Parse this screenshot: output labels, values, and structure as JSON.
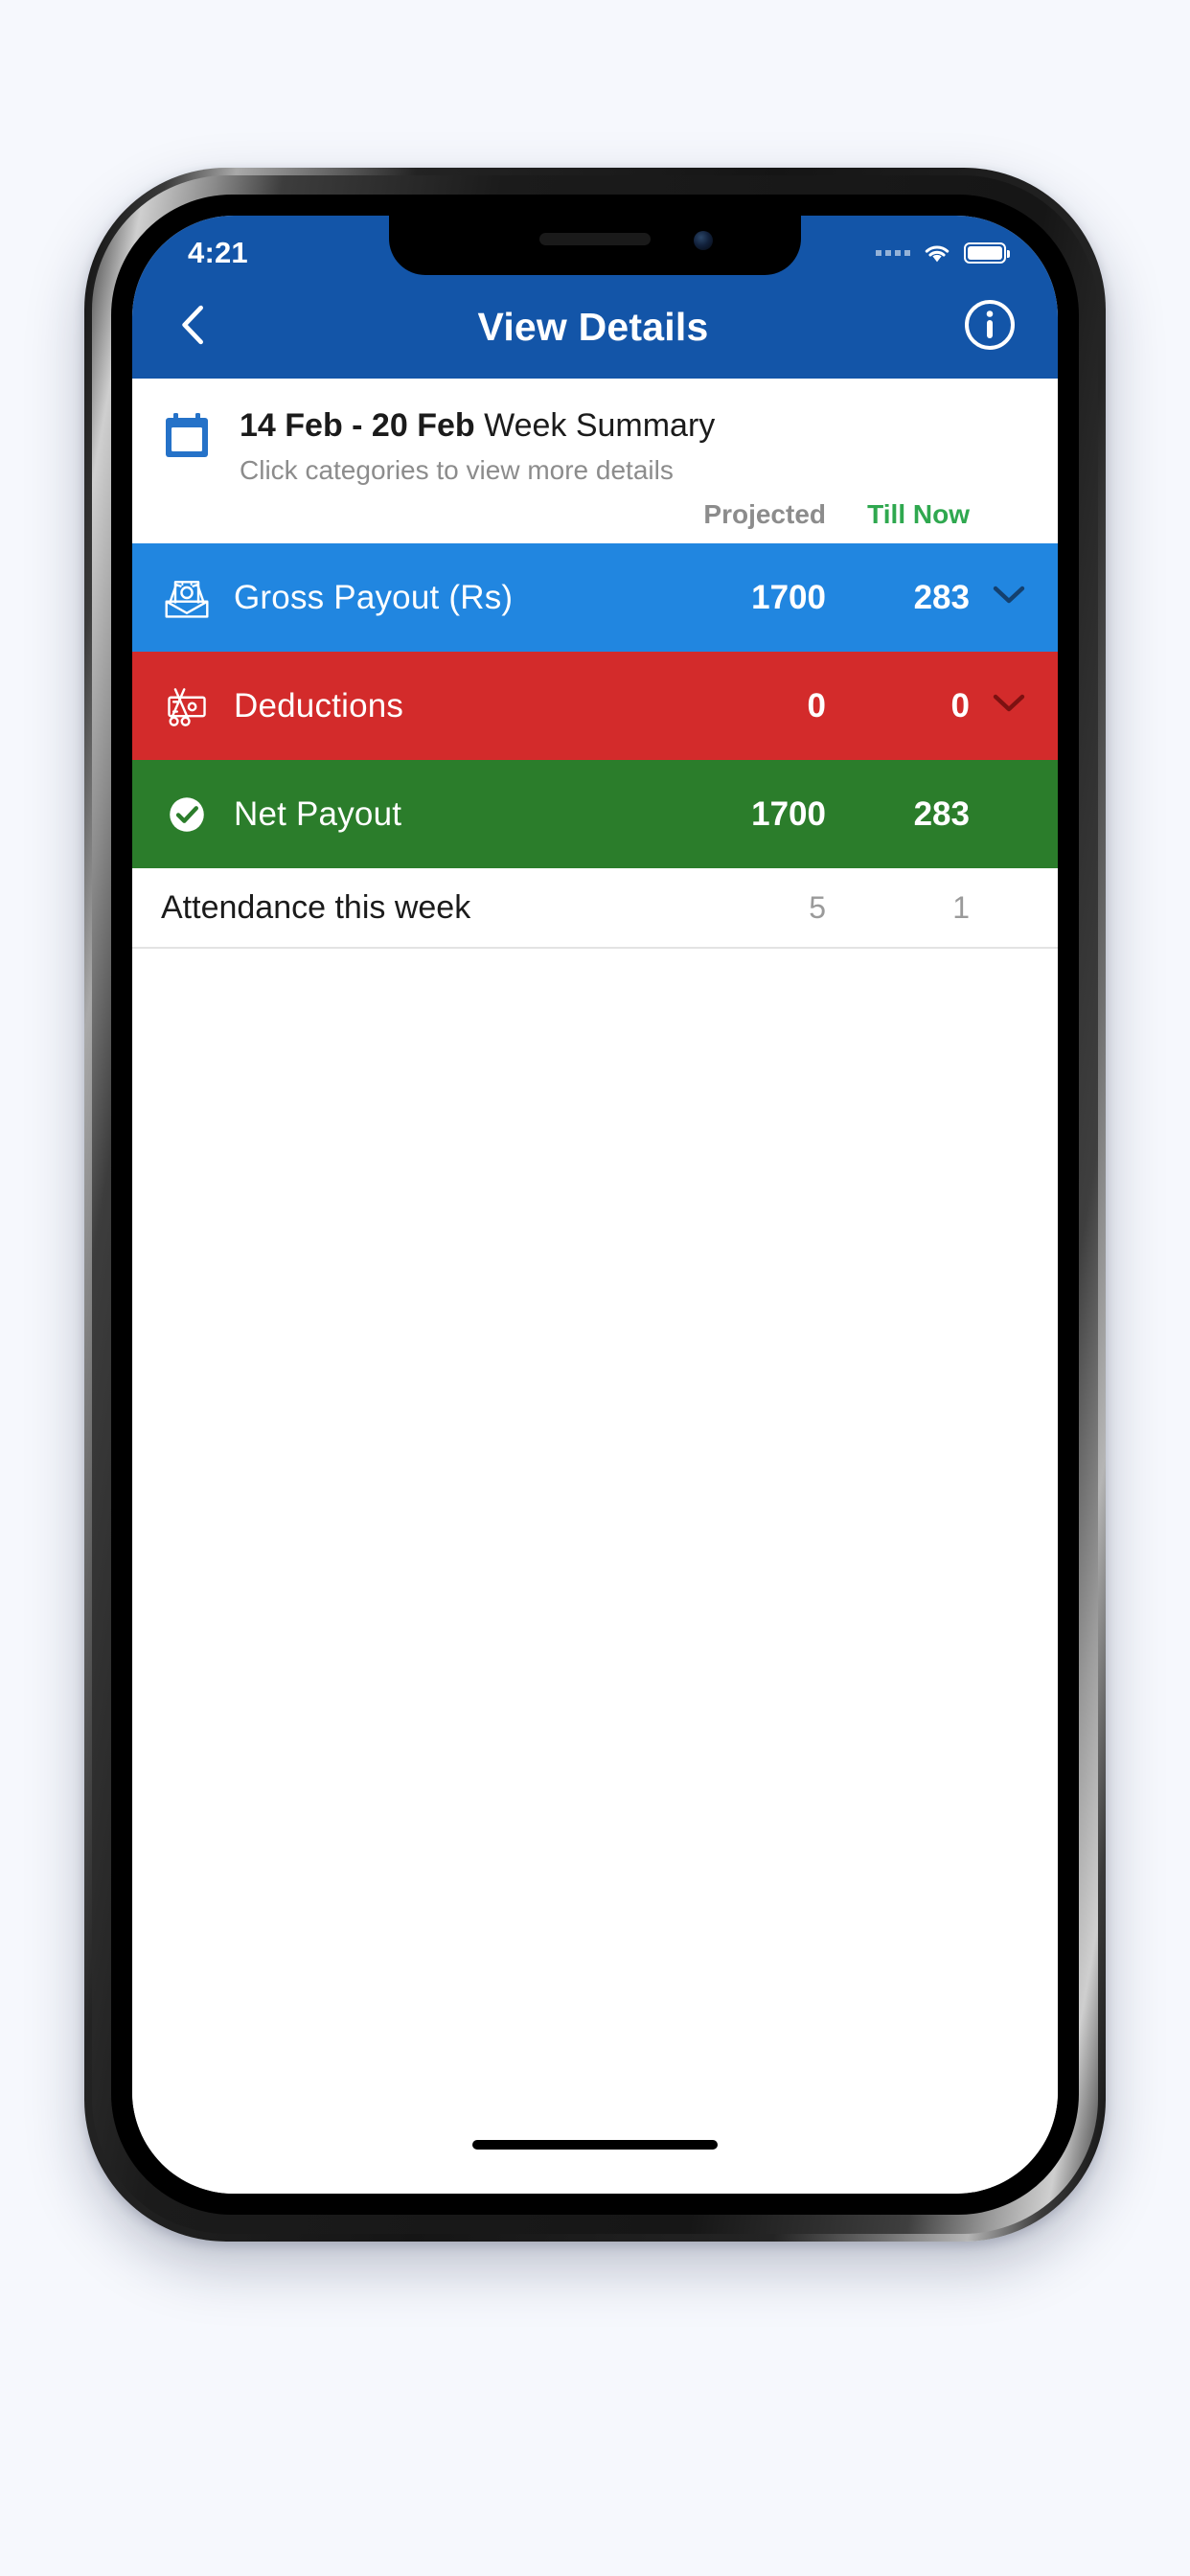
{
  "device": {
    "status_bar": {
      "time": "4:21",
      "signal_icon": "signal-dots-icon",
      "wifi_icon": "wifi-icon",
      "battery_icon": "battery-full-icon"
    },
    "home_indicator": "home-indicator"
  },
  "app_bar": {
    "back_icon": "chevron-left-icon",
    "title": "View Details",
    "info_icon": "info-circle-icon",
    "background_color": "#1355a8"
  },
  "summary": {
    "calendar_icon": "calendar-icon",
    "date_range": "14 Feb - 20 Feb",
    "title_suffix": " Week Summary",
    "subtitle": "Click categories to view more details"
  },
  "columns": {
    "projected_label": "Projected",
    "projected_color": "#8c8c8c",
    "till_now_label": "Till Now",
    "till_now_color": "#2fa84f"
  },
  "categories": [
    {
      "id": "gross-payout",
      "label": "Gross Payout (Rs)",
      "icon": "money-envelope-icon",
      "projected": "1700",
      "till_now": "283",
      "expandable": true,
      "chevron_icon": "chevron-down-icon",
      "background_color": "#2186e0"
    },
    {
      "id": "deductions",
      "label": "Deductions",
      "icon": "scissors-cut-money-icon",
      "projected": "0",
      "till_now": "0",
      "expandable": true,
      "chevron_icon": "chevron-down-icon",
      "background_color": "#d32b2b"
    },
    {
      "id": "net-payout",
      "label": "Net Payout",
      "icon": "check-circle-icon",
      "projected": "1700",
      "till_now": "283",
      "expandable": false,
      "chevron_icon": "",
      "background_color": "#2b7d2b"
    }
  ],
  "attendance": {
    "label": "Attendance this week",
    "projected": "5",
    "till_now": "1"
  }
}
